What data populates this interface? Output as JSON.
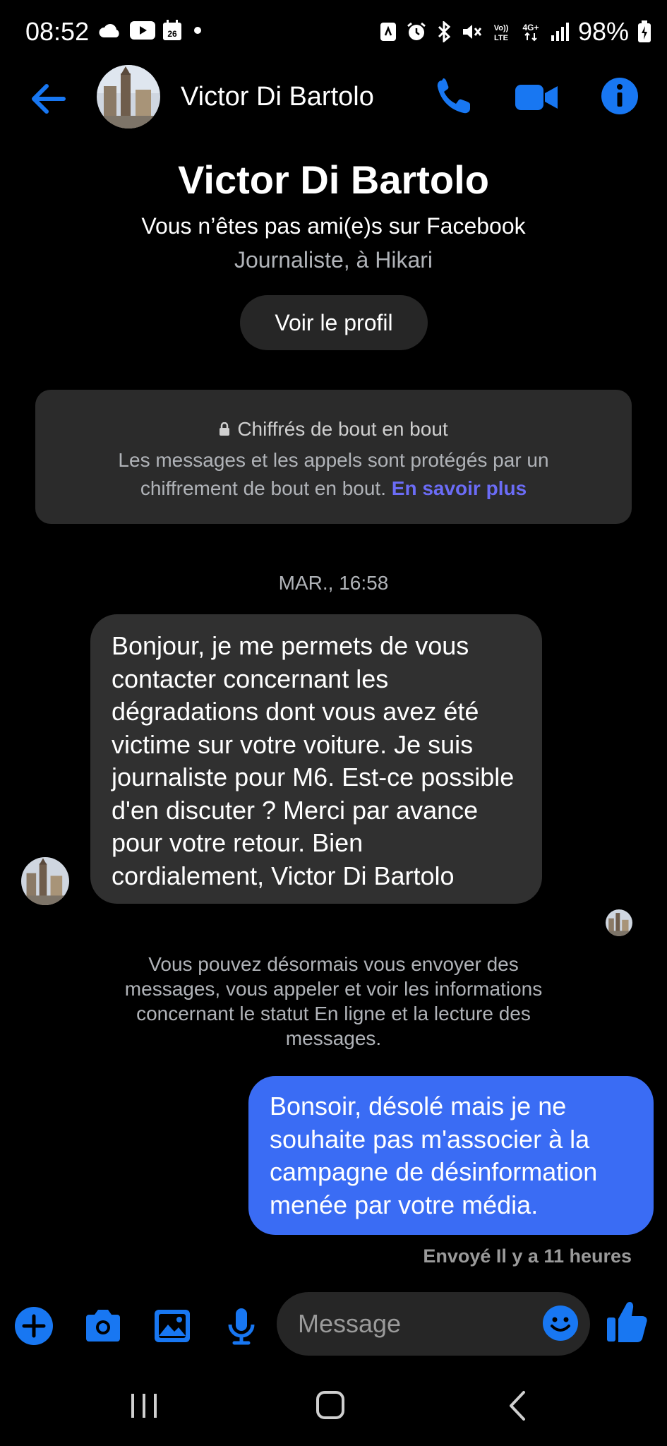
{
  "status_bar": {
    "time": "08:52",
    "calendar_day": "26",
    "battery": "98%"
  },
  "header": {
    "name": "Victor Di Bartolo"
  },
  "profile": {
    "name": "Victor Di Bartolo",
    "friend_status": "Vous n’êtes pas ami(e)s sur Facebook",
    "job": "Journaliste, à Hikari",
    "view_profile_label": "Voir le profil"
  },
  "encryption": {
    "title": "Chiffrés de bout en bout",
    "body": "Les messages et les appels sont protégés par un chiffrement de bout en bout.",
    "link": "En savoir plus"
  },
  "conversation": {
    "timestamp": "MAR., 16:58",
    "incoming_message": "Bonjour, je me permets de vous contacter concernant les dégradations dont vous avez été victime sur votre voiture. Je suis journaliste pour M6. Est-ce possible d'en discuter ? Merci par avance pour votre retour. Bien cordialement, Victor Di Bartolo",
    "system_note": "Vous pouvez désormais vous envoyer des messages, vous appeler et voir les informations concernant le statut En ligne et la lecture des messages.",
    "outgoing_message": "Bonsoir, désolé mais je ne souhaite pas m'associer à la campagne de désinformation menée par votre média.",
    "sent_status": "Envoyé Il y a 11 heures"
  },
  "composer": {
    "placeholder": "Message"
  },
  "colors": {
    "accent": "#1877f2",
    "outgoing_bubble": "#3a6cf4",
    "incoming_bubble": "#303030",
    "link": "#6b6cf6"
  },
  "icons": [
    "cloud-icon",
    "youtube-icon",
    "calendar-icon",
    "dot-icon",
    "nfc-icon",
    "alarm-icon",
    "bluetooth-icon",
    "mute-icon",
    "volte-icon",
    "4g-icon",
    "signal-icon",
    "battery-icon",
    "back-arrow-icon",
    "phone-icon",
    "video-camera-icon",
    "info-icon",
    "lock-icon",
    "plus-icon",
    "camera-icon",
    "image-icon",
    "microphone-icon",
    "emoji-icon",
    "thumbs-up-icon",
    "recents-icon",
    "home-icon",
    "nav-back-icon"
  ]
}
